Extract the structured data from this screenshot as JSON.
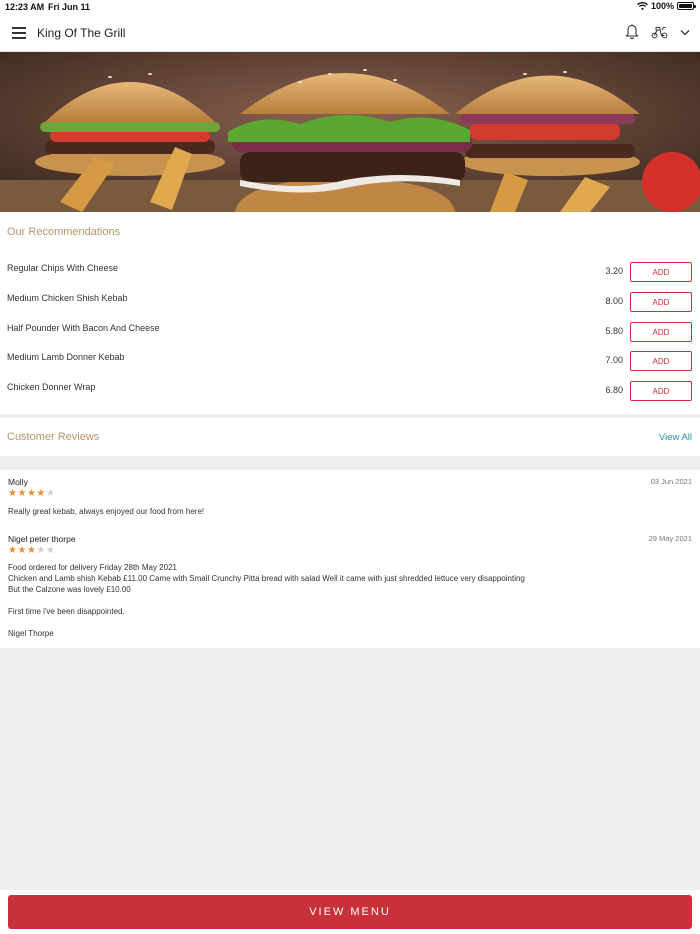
{
  "status_bar": {
    "time": "12:23 AM",
    "date": "Fri Jun 11",
    "battery": "100%"
  },
  "header": {
    "title": "King Of The Grill"
  },
  "recommendations": {
    "title": "Our Recommendations",
    "add_label": "ADD",
    "items": [
      {
        "name": "Regular Chips With Cheese",
        "price": "3.20"
      },
      {
        "name": "Medium Chicken Shish Kebab",
        "price": "8.00"
      },
      {
        "name": "Half Pounder With Bacon And Cheese",
        "price": "5.80"
      },
      {
        "name": "Medium Lamb Donner Kebab",
        "price": "7.00"
      },
      {
        "name": "Chicken Donner Wrap",
        "price": "6.80"
      }
    ]
  },
  "reviews": {
    "title": "Customer Reviews",
    "view_all": "View All",
    "items": [
      {
        "author": "Molly",
        "date": "03 Jun 2021",
        "rating": 4,
        "lines": [
          "Really great kebab, always enjoyed our food from here!"
        ]
      },
      {
        "author": "Nigel peter thorpe",
        "date": "29 May 2021",
        "rating": 3,
        "lines": [
          "Food ordered for delivery Friday 28th May 2021",
          "Chicken and Lamb shish Kebab £11.00 Came with Small Crunchy Pitta bread with salad Well it came with just shredded lettuce very disappointing",
          "But the Calzone was lovely £10.00",
          "",
          "First time i've been disappointed.",
          "",
          "Nigel Thorpe"
        ]
      }
    ]
  },
  "footer": {
    "view_menu": "VIEW MENU"
  },
  "colors": {
    "accent": "#c8313a",
    "section_title": "#b8946a",
    "link": "#2a92b0",
    "star": "#e8922e"
  }
}
